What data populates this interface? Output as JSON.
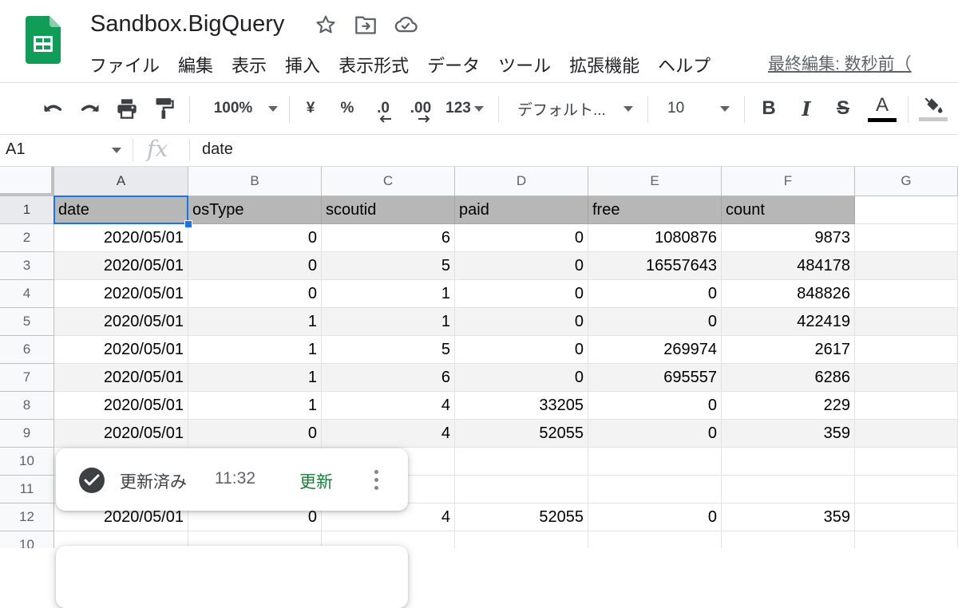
{
  "header": {
    "title": "Sandbox.BigQuery",
    "icons": [
      "star-icon",
      "move-to-folder-icon",
      "cloud-saved-icon"
    ],
    "menus": [
      "ファイル",
      "編集",
      "表示",
      "挿入",
      "表示形式",
      "データ",
      "ツール",
      "拡張機能",
      "ヘルプ"
    ],
    "last_edit": "最終編集: 数秒前（"
  },
  "toolbar": {
    "zoom": "100%",
    "currency": "¥",
    "percent": "%",
    "decimal_decrease": ".0",
    "decimal_increase": ".00",
    "more_formats": "123",
    "font": "デフォルト...",
    "font_size": "10",
    "icons": [
      "undo-icon",
      "redo-icon",
      "print-icon",
      "paint-format-icon",
      "bold-icon",
      "italic-icon",
      "strikethrough-icon",
      "text-color-icon",
      "fill-color-icon"
    ],
    "colors": {
      "text_color": "#000000",
      "fill_color": "#c9c9c9"
    }
  },
  "formula_bar": {
    "name_box": "A1",
    "fx": "fx",
    "value": "date"
  },
  "grid": {
    "columns": [
      "A",
      "B",
      "C",
      "D",
      "E",
      "F",
      "G"
    ],
    "row_numbers": [
      "1",
      "2",
      "3",
      "4",
      "5",
      "6",
      "7",
      "8",
      "9",
      "10",
      "11",
      "12",
      "10"
    ],
    "header_row": [
      "date",
      "osType",
      "scoutid",
      "paid",
      "free",
      "count"
    ],
    "rows": [
      [
        "2020/05/01",
        "0",
        "6",
        "0",
        "1080876",
        "9873"
      ],
      [
        "2020/05/01",
        "0",
        "5",
        "0",
        "16557643",
        "484178"
      ],
      [
        "2020/05/01",
        "0",
        "1",
        "0",
        "0",
        "848826"
      ],
      [
        "2020/05/01",
        "1",
        "1",
        "0",
        "0",
        "422419"
      ],
      [
        "2020/05/01",
        "1",
        "5",
        "0",
        "269974",
        "2617"
      ],
      [
        "2020/05/01",
        "1",
        "6",
        "0",
        "695557",
        "6286"
      ],
      [
        "2020/05/01",
        "1",
        "4",
        "33205",
        "0",
        "229"
      ],
      [
        "2020/05/01",
        "0",
        "4",
        "52055",
        "0",
        "359"
      ]
    ],
    "ghost_row": [
      "2020/05/01",
      "0",
      "4",
      "52055",
      "0",
      "359"
    ],
    "colors": {
      "header_fill": "#b7b7b7",
      "band_fill": "#f3f3f3",
      "selection": "#1a73e8"
    }
  },
  "snackbar": {
    "status": "更新済み",
    "time": "11:32",
    "action": "更新",
    "colors": {
      "action": "#188038"
    }
  }
}
